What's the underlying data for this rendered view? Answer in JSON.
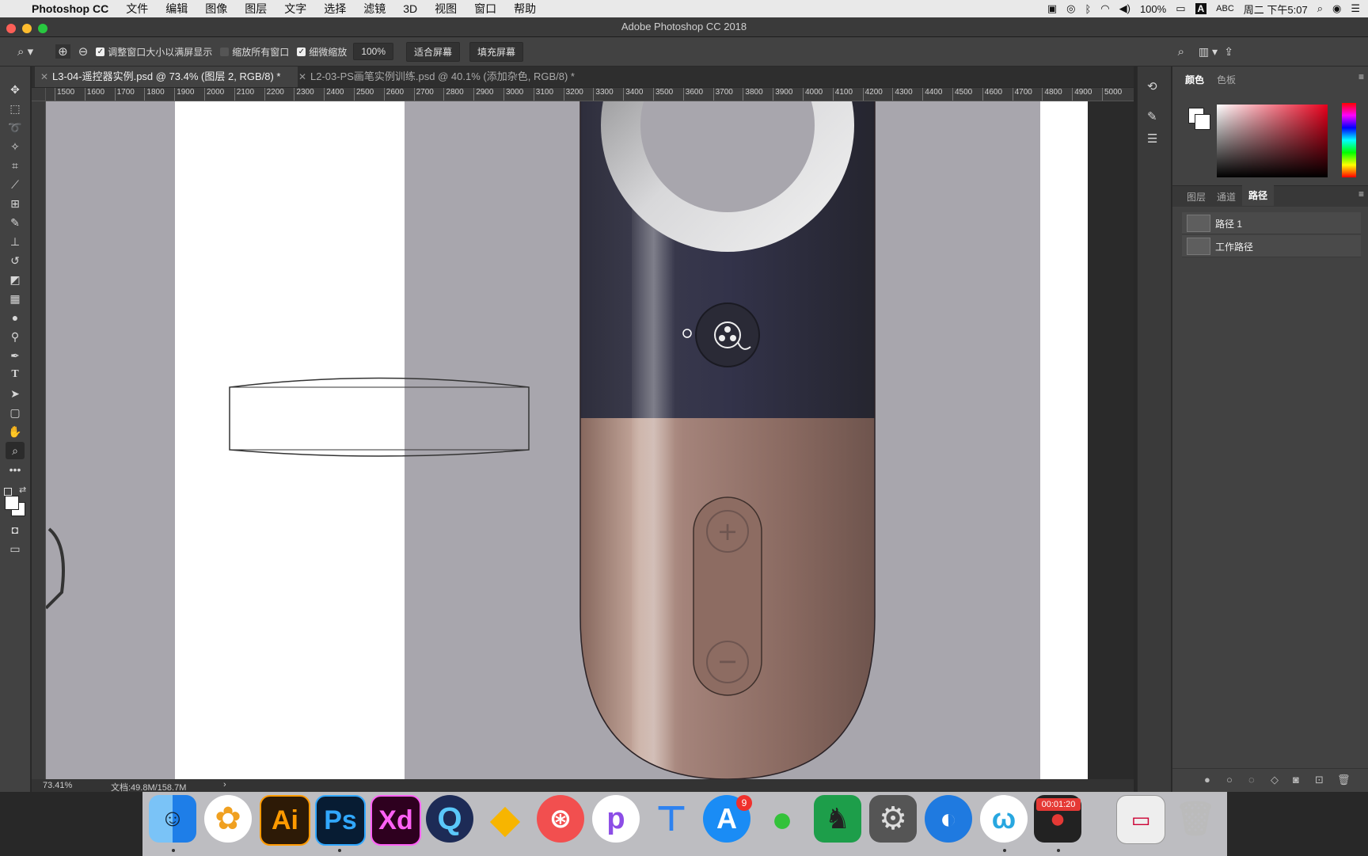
{
  "menubar": {
    "app_name": "Photoshop CC",
    "items": [
      "文件",
      "编辑",
      "图像",
      "图层",
      "文字",
      "选择",
      "滤镜",
      "3D",
      "视图",
      "窗口",
      "帮助"
    ],
    "battery": "100%",
    "input_method": "ABC",
    "clock": "周二 下午5:07"
  },
  "window": {
    "title": "Adobe Photoshop CC 2018"
  },
  "options": {
    "resize_windows_label": "调整窗口大小以满屏显示",
    "zoom_all_label": "缩放所有窗口",
    "scrubby_zoom_label": "细微缩放",
    "zoom_100": "100%",
    "fit_screen": "适合屏幕",
    "fill_screen": "填充屏幕"
  },
  "tabs": [
    {
      "label": "L3-04-遥控器实例.psd @ 73.4% (图层 2, RGB/8) *"
    },
    {
      "label": "L2-03-PS画笔实例训练.psd @ 40.1% (添加杂色, RGB/8) *"
    }
  ],
  "ruler": {
    "h_ticks": [
      "1500",
      "1600",
      "1700",
      "1800",
      "1900",
      "2000",
      "2100",
      "2200",
      "2300",
      "2400",
      "2500",
      "2600",
      "2700",
      "2800",
      "2900",
      "3000",
      "3100",
      "3200",
      "3300",
      "3400",
      "3500",
      "3600",
      "3700",
      "3800",
      "3900",
      "4000",
      "4100",
      "4200",
      "4300",
      "4400",
      "4500",
      "4600",
      "4700",
      "4800",
      "4900",
      "5000"
    ]
  },
  "status": {
    "zoom": "73.41%",
    "doc": "文档:49.8M/158.7M"
  },
  "color_panel": {
    "tab_color": "颜色",
    "tab_swatches": "色板"
  },
  "paths_panel": {
    "tab_layers": "图层",
    "tab_channels": "通道",
    "tab_paths": "路径",
    "paths": [
      "路径 1",
      "工作路径"
    ]
  },
  "dock": {
    "badge_appstore": "9",
    "recorder_time": "00:01:20",
    "apps": [
      "Finder",
      "Photos",
      "Illustrator",
      "Photoshop",
      "Adobe XD",
      "QuickTime",
      "Sketch",
      "Lattice",
      "Pockity",
      "Keynote",
      "App Store",
      "WeChat",
      "Evernote",
      "System Preferences",
      "Safari-like",
      "Wunderlist",
      "Recorder",
      "Preview",
      "Trash"
    ],
    "ai_label": "Ai",
    "ps_label": "Ps",
    "xd_label": "Xd"
  },
  "colors": {
    "accent": "#2d8cf0",
    "canvas_gray": "#a8a6ad",
    "remote_top": "#2f2f3e",
    "remote_bottom": "#9a7266"
  }
}
